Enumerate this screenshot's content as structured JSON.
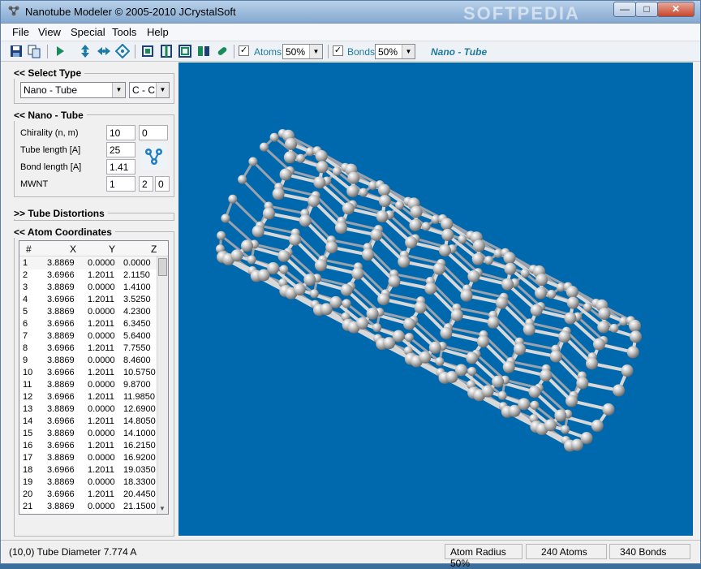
{
  "window": {
    "title": "Nanotube Modeler © 2005-2010 JCrystalSoft",
    "watermark": "SOFTPEDIA",
    "controls": {
      "minimize": "—",
      "maximize": "□",
      "close": "✕"
    }
  },
  "menu": [
    "File",
    "View",
    "Special",
    "Tools",
    "Help"
  ],
  "toolbar": {
    "atoms_label": "Atoms",
    "atoms_checked": "✓",
    "atoms_percent": "50%",
    "bonds_label": "Bonds",
    "bonds_checked": "✓",
    "bonds_percent": "50%",
    "mode_text": "Nano - Tube"
  },
  "select_type": {
    "header": "<<  Select Type",
    "type_value": "Nano - Tube",
    "element_value": "C - C"
  },
  "nanotube": {
    "header": "<<  Nano - Tube",
    "chirality_label": "Chirality  (n, m)",
    "chirality_n": "10",
    "chirality_m": "0",
    "tube_length_label": "Tube length [A]",
    "tube_length": "25",
    "bond_length_label": "Bond length [A]",
    "bond_length": "1.41",
    "mwnt_label": "MWNT",
    "mwnt_1": "1",
    "mwnt_2": "2",
    "mwnt_3": "0"
  },
  "distortions": {
    "header": ">>  Tube Distortions"
  },
  "coordinates": {
    "header": "<<  Atom Coordinates",
    "columns": [
      "#",
      "X",
      "Y",
      "Z"
    ],
    "rows": [
      [
        "1",
        "3.8869",
        "0.0000",
        "0.0000"
      ],
      [
        "2",
        "3.6966",
        "1.2011",
        "2.1150"
      ],
      [
        "3",
        "3.8869",
        "0.0000",
        "1.4100"
      ],
      [
        "4",
        "3.6966",
        "1.2011",
        "3.5250"
      ],
      [
        "5",
        "3.8869",
        "0.0000",
        "4.2300"
      ],
      [
        "6",
        "3.6966",
        "1.2011",
        "6.3450"
      ],
      [
        "7",
        "3.8869",
        "0.0000",
        "5.6400"
      ],
      [
        "8",
        "3.6966",
        "1.2011",
        "7.7550"
      ],
      [
        "9",
        "3.8869",
        "0.0000",
        "8.4600"
      ],
      [
        "10",
        "3.6966",
        "1.2011",
        "10.5750"
      ],
      [
        "11",
        "3.8869",
        "0.0000",
        "9.8700"
      ],
      [
        "12",
        "3.6966",
        "1.2011",
        "11.9850"
      ],
      [
        "13",
        "3.8869",
        "0.0000",
        "12.6900"
      ],
      [
        "14",
        "3.6966",
        "1.2011",
        "14.8050"
      ],
      [
        "15",
        "3.8869",
        "0.0000",
        "14.1000"
      ],
      [
        "16",
        "3.6966",
        "1.2011",
        "16.2150"
      ],
      [
        "17",
        "3.8869",
        "0.0000",
        "16.9200"
      ],
      [
        "18",
        "3.6966",
        "1.2011",
        "19.0350"
      ],
      [
        "19",
        "3.8869",
        "0.0000",
        "18.3300"
      ],
      [
        "20",
        "3.6966",
        "1.2011",
        "20.4450"
      ],
      [
        "21",
        "3.8869",
        "0.0000",
        "21.1500"
      ]
    ]
  },
  "status": {
    "diameter": "(10,0) Tube Diameter 7.774 A",
    "atom_radius": "Atom Radius 50%",
    "atoms": "240 Atoms",
    "bonds": "340 Bonds"
  },
  "colors": {
    "viewport_bg": "#0069ad",
    "accent_text": "#1f7a9c",
    "atom": "#c8c8c8",
    "bond": "#d8d8d8"
  }
}
